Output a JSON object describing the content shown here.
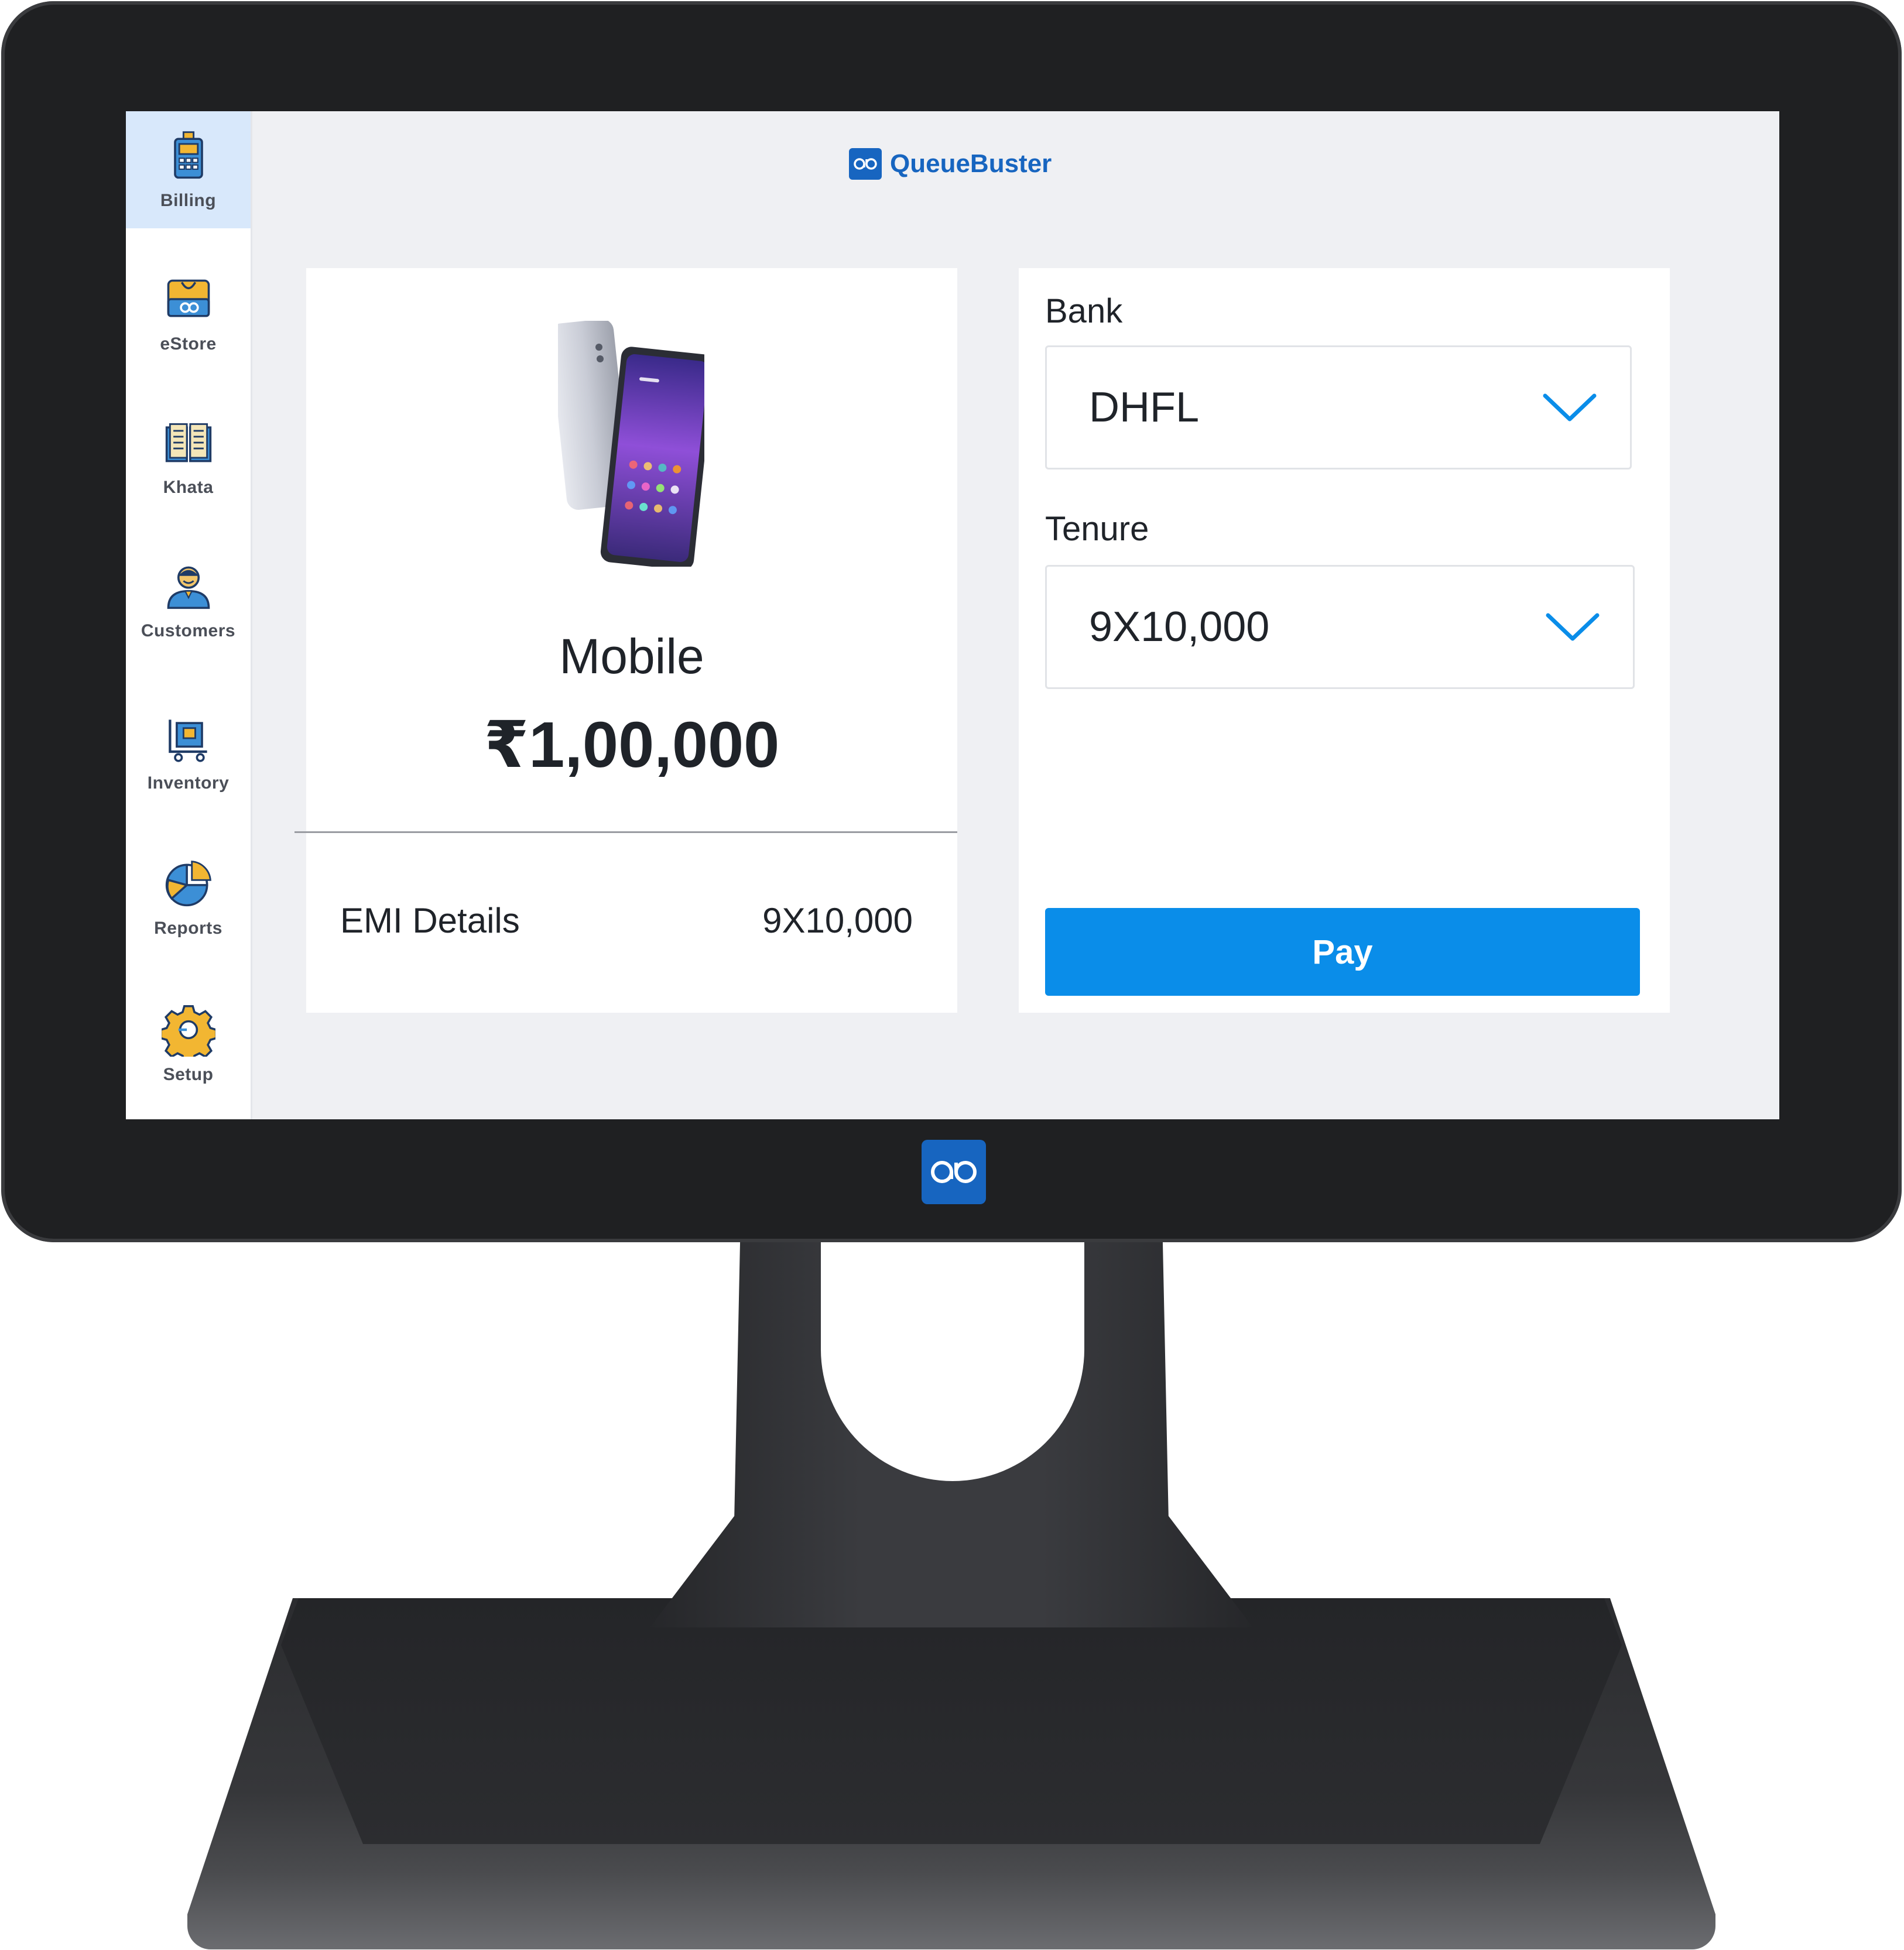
{
  "brand": {
    "name": "QueueBuster",
    "logo_icon": "qb-logo-icon",
    "color": "#1765c0"
  },
  "sidebar": {
    "items": [
      {
        "label": "Billing",
        "icon": "billing-terminal-icon",
        "active": true
      },
      {
        "label": "eStore",
        "icon": "estore-bag-icon",
        "active": false
      },
      {
        "label": "Khata",
        "icon": "khata-book-icon",
        "active": false
      },
      {
        "label": "Customers",
        "icon": "customer-person-icon",
        "active": false
      },
      {
        "label": "Inventory",
        "icon": "inventory-cart-icon",
        "active": false
      },
      {
        "label": "Reports",
        "icon": "reports-pie-icon",
        "active": false
      },
      {
        "label": "Setup",
        "icon": "setup-gear-icon",
        "active": false
      }
    ]
  },
  "product": {
    "name": "Mobile",
    "price": "₹1,00,000",
    "image_icon": "smartphone-image",
    "emi_label": "EMI Details",
    "emi_value": "9X10,000"
  },
  "payment": {
    "bank_label": "Bank",
    "bank_value": "DHFL",
    "tenure_label": "Tenure",
    "tenure_value": "9X10,000",
    "pay_label": "Pay",
    "accent": "#0a8de9"
  }
}
